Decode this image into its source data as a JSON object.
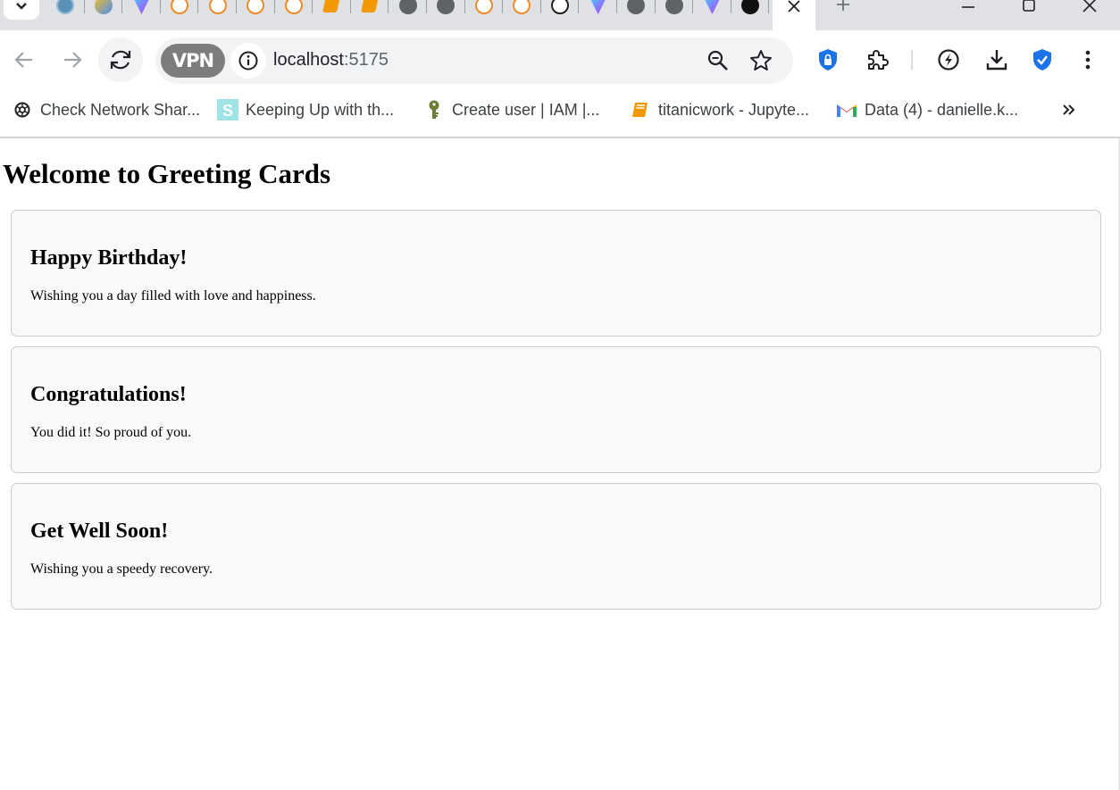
{
  "browser": {
    "tab_strip": {
      "favicons": [
        "owl",
        "gem",
        "vite",
        "edge",
        "edge",
        "edge",
        "edge",
        "book",
        "book",
        "globe",
        "globe",
        "edge",
        "edge",
        "gpt",
        "vite",
        "globe",
        "globe",
        "vite",
        "gh"
      ]
    },
    "address_bar": {
      "vpn_label": "VPN",
      "url_host": "localhost",
      "url_port": ":5175"
    },
    "bookmarks": [
      {
        "label": "Check Network Shar...",
        "icon": "chatgpt-icon"
      },
      {
        "label": "Keeping Up with th...",
        "icon": "s-letter-icon"
      },
      {
        "label": "Create user | IAM |...",
        "icon": "key-icon"
      },
      {
        "label": "titanicwork - Jupyte...",
        "icon": "book-icon"
      },
      {
        "label": "Data (4) - danielle.k...",
        "icon": "gmail-icon"
      }
    ],
    "colors": {
      "accent_blue": "#1a73e8",
      "gmail_red": "#ea4335",
      "tab_strip_bg": "#dfe1e5"
    }
  },
  "page": {
    "title": "Welcome to Greeting Cards",
    "cards": [
      {
        "title": "Happy Birthday!",
        "message": "Wishing you a day filled with love and happiness."
      },
      {
        "title": "Congratulations!",
        "message": "You did it! So proud of you."
      },
      {
        "title": "Get Well Soon!",
        "message": "Wishing you a speedy recovery."
      }
    ]
  }
}
